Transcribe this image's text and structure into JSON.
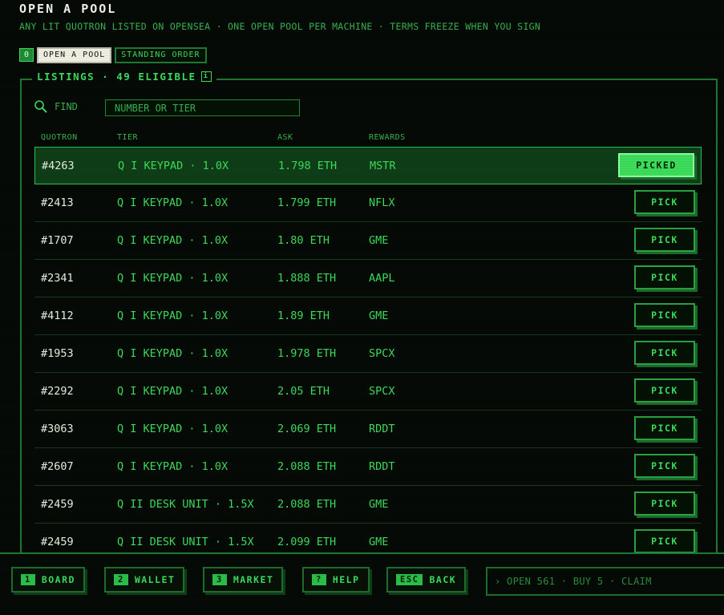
{
  "header": {
    "title": "OPEN A POOL",
    "subtitle": "ANY LIT QUOTRON LISTED ON OPENSEA · ONE OPEN POOL PER MACHINE · TERMS FREEZE WHEN YOU SIGN"
  },
  "modebar": {
    "key": "0",
    "tabs": [
      {
        "label": "OPEN A POOL",
        "active": true
      },
      {
        "label": "STANDING ORDER",
        "active": false
      }
    ]
  },
  "listings": {
    "legend": "LISTINGS · 49 ELIGIBLE",
    "badge": "i",
    "find_label": "FIND",
    "find_placeholder": "NUMBER OR TIER",
    "columns": [
      "QUOTRON",
      "TIER",
      "ASK",
      "REWARDS"
    ],
    "rows": [
      {
        "quotron": "#4263",
        "tier": "Q I KEYPAD · 1.0X",
        "ask": "1.798 ETH",
        "rewards": "MSTR",
        "action": "PICKED",
        "selected": true
      },
      {
        "quotron": "#2413",
        "tier": "Q I KEYPAD · 1.0X",
        "ask": "1.799 ETH",
        "rewards": "NFLX",
        "action": "PICK",
        "selected": false
      },
      {
        "quotron": "#1707",
        "tier": "Q I KEYPAD · 1.0X",
        "ask": "1.80 ETH",
        "rewards": "GME",
        "action": "PICK",
        "selected": false
      },
      {
        "quotron": "#2341",
        "tier": "Q I KEYPAD · 1.0X",
        "ask": "1.888 ETH",
        "rewards": "AAPL",
        "action": "PICK",
        "selected": false
      },
      {
        "quotron": "#4112",
        "tier": "Q I KEYPAD · 1.0X",
        "ask": "1.89 ETH",
        "rewards": "GME",
        "action": "PICK",
        "selected": false
      },
      {
        "quotron": "#1953",
        "tier": "Q I KEYPAD · 1.0X",
        "ask": "1.978 ETH",
        "rewards": "SPCX",
        "action": "PICK",
        "selected": false
      },
      {
        "quotron": "#2292",
        "tier": "Q I KEYPAD · 1.0X",
        "ask": "2.05 ETH",
        "rewards": "SPCX",
        "action": "PICK",
        "selected": false
      },
      {
        "quotron": "#3063",
        "tier": "Q I KEYPAD · 1.0X",
        "ask": "2.069 ETH",
        "rewards": "RDDT",
        "action": "PICK",
        "selected": false
      },
      {
        "quotron": "#2607",
        "tier": "Q I KEYPAD · 1.0X",
        "ask": "2.088 ETH",
        "rewards": "RDDT",
        "action": "PICK",
        "selected": false
      },
      {
        "quotron": "#2459",
        "tier": "Q II DESK UNIT · 1.5X",
        "ask": "2.088 ETH",
        "rewards": "GME",
        "action": "PICK",
        "selected": false
      },
      {
        "quotron": "#2459",
        "tier": "Q II DESK UNIT · 1.5X",
        "ask": "2.099 ETH",
        "rewards": "GME",
        "action": "PICK",
        "selected": false
      }
    ]
  },
  "footer": {
    "buttons": [
      {
        "key": "1",
        "label": "BOARD"
      },
      {
        "key": "2",
        "label": "WALLET"
      },
      {
        "key": "3",
        "label": "MARKET"
      },
      {
        "key": "?",
        "label": "HELP"
      },
      {
        "key": "ESC",
        "label": "BACK"
      }
    ],
    "command_line": "› OPEN 561 · BUY 5 · CLAIM"
  },
  "colors": {
    "background": "#050905",
    "accent": "#3ddc5c",
    "border": "#1d7a31",
    "selected_row": "#0f3d17"
  }
}
